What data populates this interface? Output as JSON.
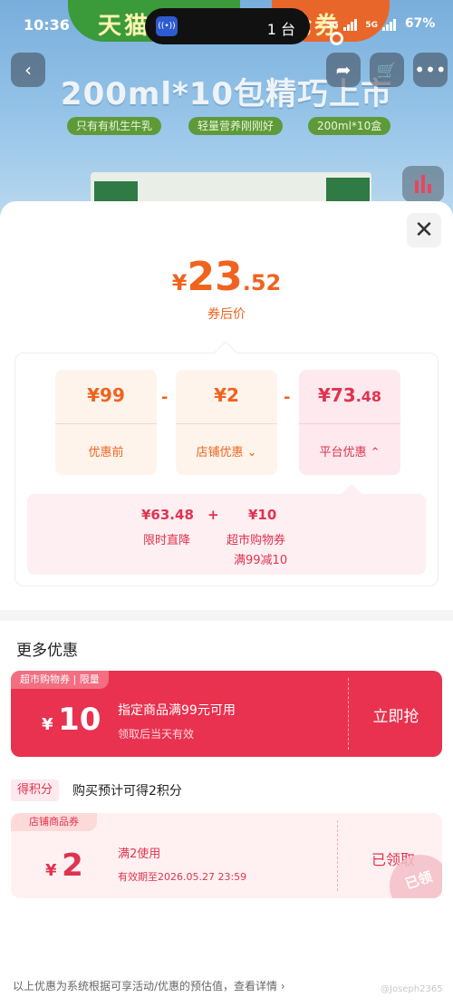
{
  "status_bar": {
    "time": "10:36",
    "island_text": "1 台",
    "network1": "5G",
    "network2": "5G",
    "battery": "67%"
  },
  "background": {
    "brand_left": "天猫",
    "brand_right": "抢券",
    "headline": "200ml*10包精巧上市",
    "tags": [
      "只有有机生牛乳",
      "轻量营养刚刚好",
      "200ml*10盒"
    ]
  },
  "price": {
    "currency": "¥",
    "integer": "23",
    "decimal": ".52",
    "label": "券后价"
  },
  "breakdown": {
    "original": {
      "amount": "¥99",
      "label": "优惠前"
    },
    "store": {
      "amount": "¥2",
      "label": "店铺优惠 ⌄"
    },
    "platform": {
      "amount_main": "¥73",
      "amount_dec": ".48",
      "label": "平台优惠 ⌃"
    },
    "operator_minus": "-",
    "platform_detail": {
      "item1_amount": "¥63.48",
      "item1_label": "限时直降",
      "plus": "+",
      "item2_amount": "¥10",
      "item2_label": "超市购物券",
      "item2_sub": "满99减10"
    }
  },
  "more_offers": {
    "title": "更多优惠",
    "coupon1": {
      "tag": "超市购物券 | 限量",
      "currency": "¥",
      "amount": "10",
      "condition": "指定商品满99元可用",
      "validity": "领取后当天有效",
      "button": "立即抢"
    },
    "points": {
      "badge": "得积分",
      "text": "购买预计可得2积分"
    },
    "coupon2": {
      "tag": "店铺商品券",
      "currency": "¥",
      "amount": "2",
      "condition": "满2使用",
      "validity": "有效期至2026.05.27 23:59",
      "button": "已领取",
      "stamp": "已领"
    }
  },
  "footer": {
    "note": "以上优惠为系统根据可享活动/优惠的预估值，查看详情 ›",
    "watermark": "@Joseph2365"
  },
  "colors": {
    "accent_orange": "#f0631f",
    "accent_red": "#e8324f",
    "pink_bg": "#fdeff2"
  }
}
